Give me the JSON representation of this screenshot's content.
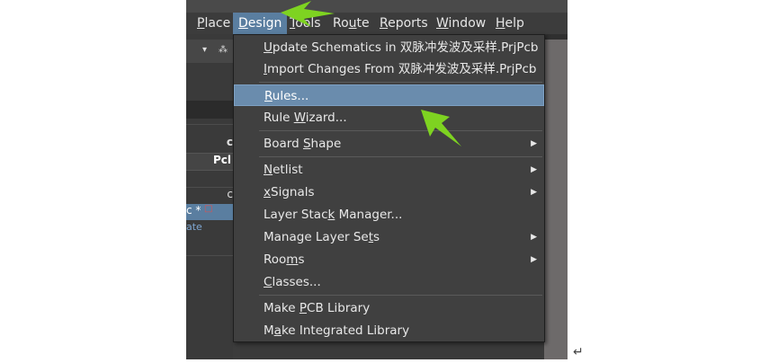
{
  "menubar": {
    "items": [
      {
        "label": "Place",
        "mn": "P",
        "rest": "lace"
      },
      {
        "label": "Design",
        "mn": "D",
        "rest": "esign"
      },
      {
        "label": "Tools",
        "mn": "T",
        "rest": "ools"
      },
      {
        "label": "Route",
        "pre": "Ro",
        "mn": "u",
        "rest": "te"
      },
      {
        "label": "Reports",
        "mn": "R",
        "rest": "eports"
      },
      {
        "label": "Window",
        "mn": "W",
        "rest": "indow"
      },
      {
        "label": "Help",
        "mn": "H",
        "rest": "elp"
      }
    ]
  },
  "left_panel": {
    "pin_icon": "▾",
    "pin2_icon": "⁂",
    "row1": "c",
    "row2": "Pcl",
    "row3": "c",
    "row4": "c *",
    "row4_badge": "□",
    "row5": "ate"
  },
  "design_menu": {
    "items": [
      {
        "pre": "",
        "mn": "U",
        "rest": "pdate Schematics in 双脉冲发波及采样.PrjPcb"
      },
      {
        "pre": "",
        "mn": "I",
        "rest": "mport Changes From 双脉冲发波及采样.PrjPcb"
      },
      {
        "pre": "",
        "mn": "R",
        "rest": "ules..."
      },
      {
        "pre": "Rule ",
        "mn": "W",
        "rest": "izard..."
      },
      {
        "pre": "Board ",
        "mn": "S",
        "rest": "hape"
      },
      {
        "pre": "",
        "mn": "N",
        "rest": "etlist"
      },
      {
        "pre": "",
        "mn": "x",
        "rest": "Signals"
      },
      {
        "pre": "Layer Stac",
        "mn": "k",
        "rest": " Manager..."
      },
      {
        "pre": "Manage Layer Se",
        "mn": "t",
        "rest": "s"
      },
      {
        "pre": "Roo",
        "mn": "m",
        "rest": "s"
      },
      {
        "pre": "",
        "mn": "C",
        "rest": "lasses..."
      },
      {
        "pre": "Make ",
        "mn": "P",
        "rest": "CB Library"
      },
      {
        "pre": "M",
        "mn": "a",
        "rest": "ke Integrated Library"
      }
    ],
    "submenu_arrow": "▶"
  },
  "annotation": {
    "color": "#7ed321",
    "return_mark": "↵"
  }
}
